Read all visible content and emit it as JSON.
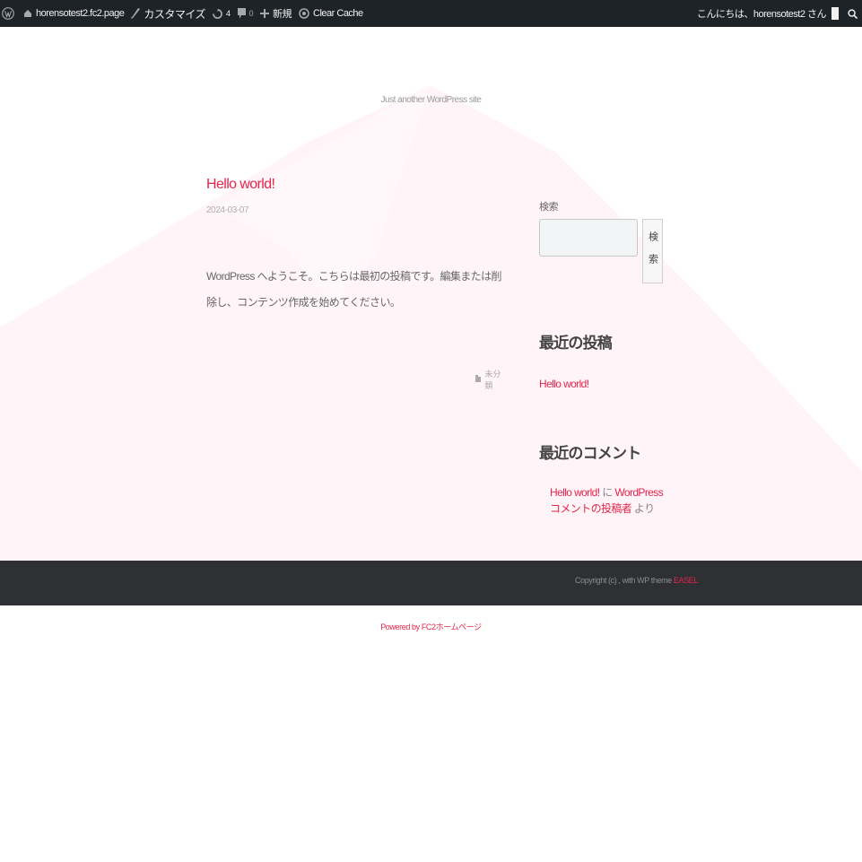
{
  "adminbar": {
    "site_name": "horensotest2.fc2.page",
    "customize": "カスタマイズ",
    "updates_count": "4",
    "comments_count": "0",
    "new_label": "新規",
    "clear_cache": "Clear Cache",
    "greeting": "こんにちは、horensotest2 さん"
  },
  "site": {
    "tagline": "Just another WordPress site"
  },
  "post": {
    "title": "Hello world!",
    "date": "2024-03-07",
    "content": "WordPress へようこそ。こちらは最初の投稿です。編集または削除し、コンテンツ作成を始めてください。",
    "category": "未分類"
  },
  "sidebar": {
    "search_label": "検索",
    "search_button": "検索",
    "recent_posts_title": "最近の投稿",
    "recent_posts": [
      "Hello world!"
    ],
    "recent_comments_title": "最近のコメント",
    "comment": {
      "post_link": "Hello world!",
      "connector": " に ",
      "author": "WordPress コメントの投稿者",
      "suffix": " より"
    }
  },
  "footer": {
    "copyright_prefix": "Copyright (c) , with WP theme ",
    "theme_name": "EASEL",
    "powered": "Powered by FC2ホームページ"
  },
  "colors": {
    "accent": "#e2264d",
    "adminbar": "#1d2327",
    "footer": "#2e3034",
    "bg_tint": "#fff4f7"
  }
}
